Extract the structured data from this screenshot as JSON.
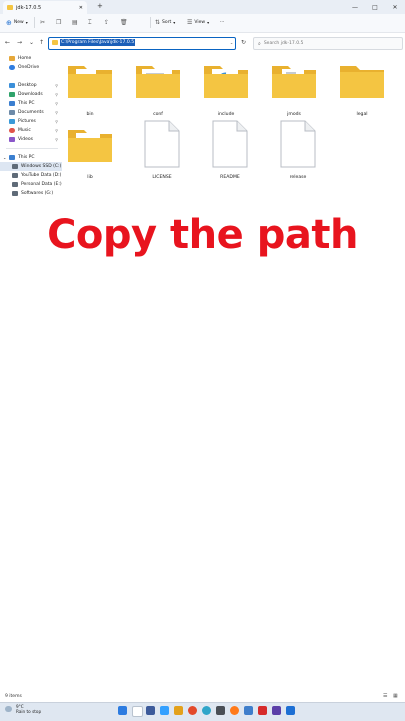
{
  "window": {
    "tab_title": "jdk-17.0.5",
    "new_tab": "+",
    "controls": [
      "—",
      "□",
      "✕"
    ]
  },
  "toolbar": {
    "new_label": "New",
    "sort_label": "Sort",
    "view_label": "View",
    "more_label": "···"
  },
  "address": {
    "path": "C:\\Program Files\\Java\\jdk-17.0.5",
    "search_placeholder": "Search jdk-17.0.5"
  },
  "sidebar": {
    "items": [
      {
        "label": "Home",
        "pinned": false,
        "color": "#e6a83a"
      },
      {
        "label": "OneDrive",
        "pinned": false,
        "color": "#2f7de1"
      },
      {
        "label": "Desktop",
        "pinned": true,
        "color": "#3b8fd9"
      },
      {
        "label": "Downloads",
        "pinned": true,
        "color": "#2fa36b"
      },
      {
        "label": "This PC",
        "pinned": true,
        "color": "#3b7fd0"
      },
      {
        "label": "Documents",
        "pinned": true,
        "color": "#6d8aa8"
      },
      {
        "label": "Pictures",
        "pinned": true,
        "color": "#3a9ad8"
      },
      {
        "label": "Music",
        "pinned": true,
        "color": "#e0544b"
      },
      {
        "label": "Videos",
        "pinned": true,
        "color": "#8a57c9"
      }
    ],
    "drives": [
      {
        "label": "This PC",
        "color": "#3b7fd0"
      },
      {
        "label": "Windows SSD (C:)",
        "color": "#5f6b78"
      },
      {
        "label": "YouTube Data (D:)",
        "color": "#5f6b78"
      },
      {
        "label": "Personal Data (E:)",
        "color": "#5f6b78"
      },
      {
        "label": "Softwares (G:)",
        "color": "#5f6b78"
      }
    ]
  },
  "files": [
    {
      "name": "bin",
      "type": "folder"
    },
    {
      "name": "conf",
      "type": "folder"
    },
    {
      "name": "include",
      "type": "folder"
    },
    {
      "name": "jmods",
      "type": "folder"
    },
    {
      "name": "legal",
      "type": "folder"
    },
    {
      "name": "lib",
      "type": "folder"
    },
    {
      "name": "LICENSE",
      "type": "file"
    },
    {
      "name": "README",
      "type": "file"
    },
    {
      "name": "release",
      "type": "file"
    }
  ],
  "caption": "Copy the path",
  "status": {
    "count": "9 items"
  },
  "taskbar": {
    "temperature": "9°C",
    "weather": "Rain to stop"
  },
  "colors": {
    "folder": "#f4c542",
    "folder_back": "#e9b12f",
    "caption": "#e8141e",
    "selection": "#1c5fb8"
  }
}
